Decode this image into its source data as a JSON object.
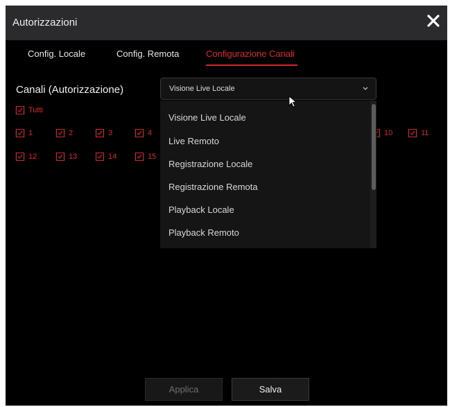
{
  "dialog": {
    "title": "Autorizzazioni",
    "close_icon": "close-icon"
  },
  "tabs": [
    {
      "label": "Config. Locale",
      "active": false
    },
    {
      "label": "Config. Remota",
      "active": false
    },
    {
      "label": "Configurazione Canali",
      "active": true
    }
  ],
  "channels": {
    "label": "Canali (Autorizzazione)",
    "selected": "Visione Live Locale",
    "options": [
      "Visione Live Locale",
      "Live Remoto",
      "Registrazione Locale",
      "Registrazione Remota",
      "Playback Locale",
      "Playback Remoto"
    ],
    "all_label": "Tutti",
    "checkboxes": [
      {
        "label": "1",
        "checked": true
      },
      {
        "label": "2",
        "checked": true
      },
      {
        "label": "3",
        "checked": true
      },
      {
        "label": "4",
        "checked": true
      },
      {
        "label": "10",
        "checked": true
      },
      {
        "label": "11",
        "checked": true
      },
      {
        "label": "12",
        "checked": true
      },
      {
        "label": "13",
        "checked": true
      },
      {
        "label": "14",
        "checked": true
      },
      {
        "label": "15",
        "checked": true
      }
    ]
  },
  "buttons": {
    "apply": "Applica",
    "save": "Salva"
  },
  "colors": {
    "accent": "#d8262b",
    "background": "#000000",
    "titlebar": "#2b2b2d"
  }
}
